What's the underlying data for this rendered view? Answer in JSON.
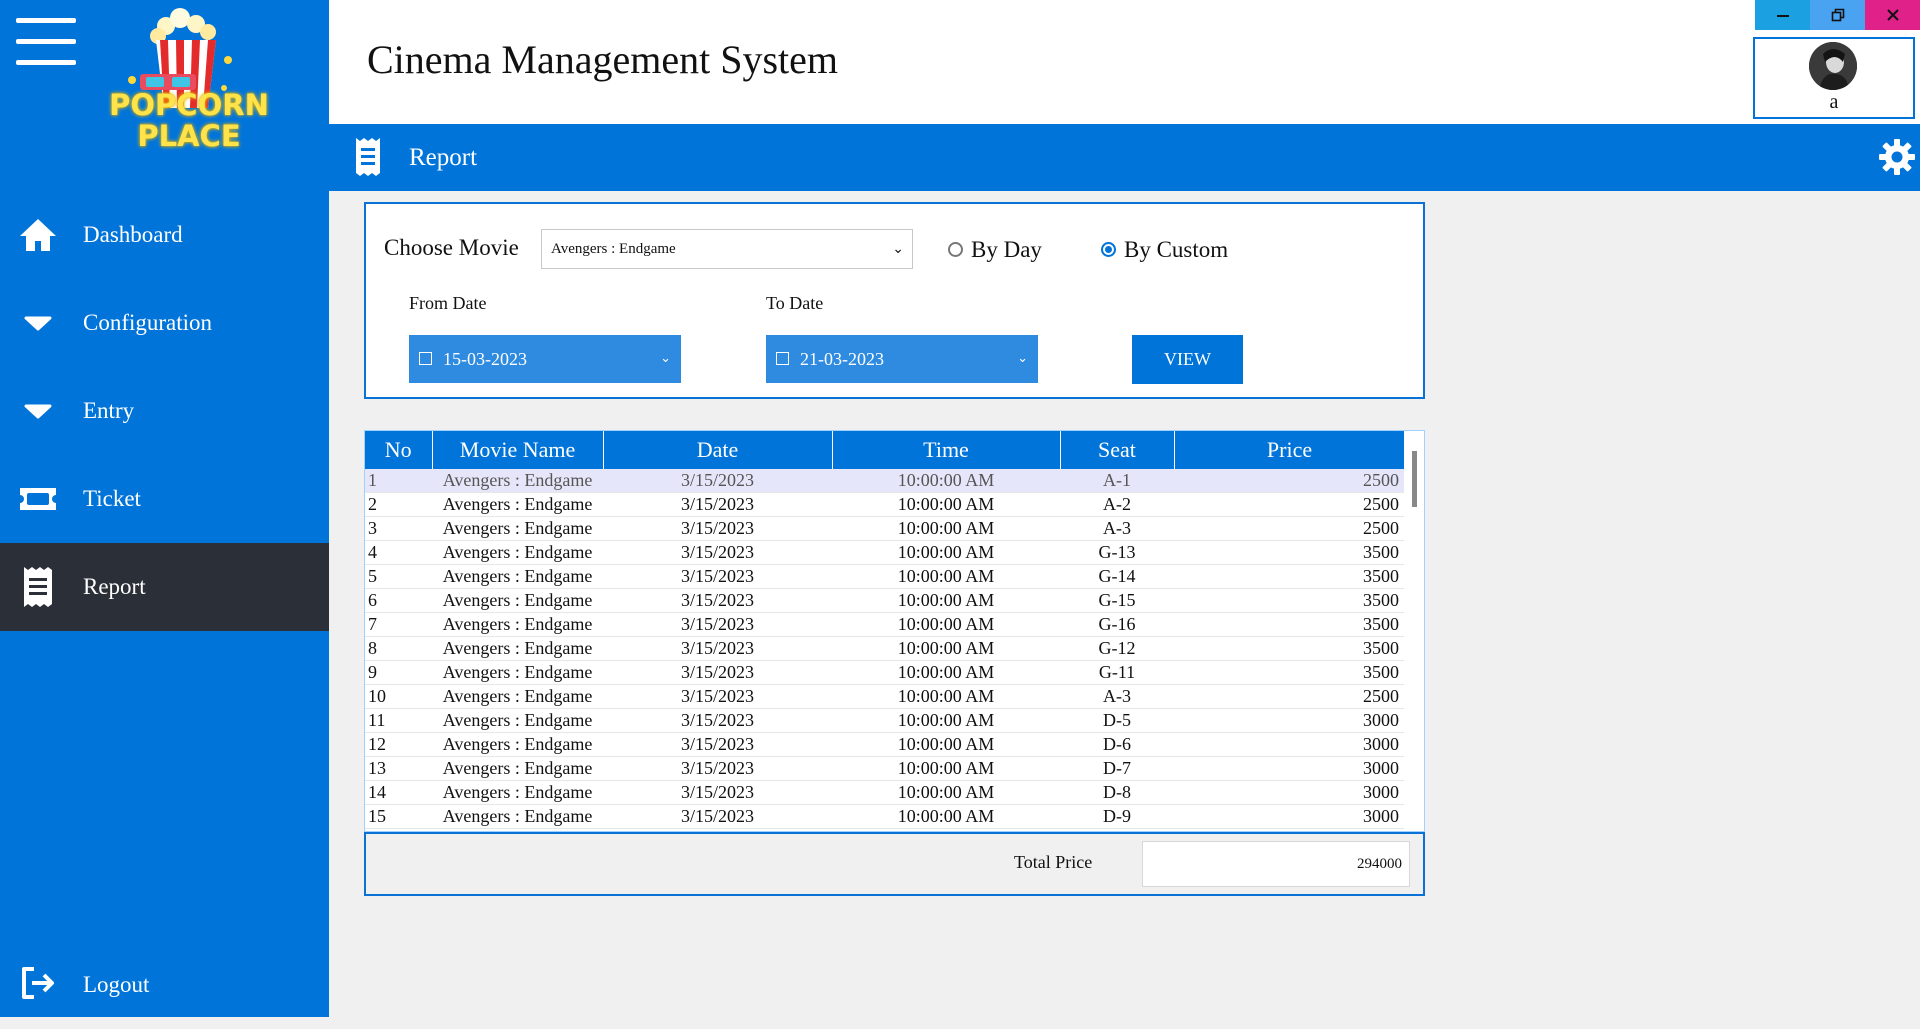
{
  "app": {
    "title": "Cinema Management System"
  },
  "logo": {
    "line1": "POPCORN",
    "line2": "PLACE"
  },
  "sidebar": {
    "items": [
      {
        "label": "Dashboard",
        "icon": "home-icon"
      },
      {
        "label": "Configuration",
        "icon": "chevron-down-icon"
      },
      {
        "label": "Entry",
        "icon": "chevron-down-icon"
      },
      {
        "label": "Ticket",
        "icon": "ticket-icon"
      },
      {
        "label": "Report",
        "icon": "receipt-icon",
        "active": true
      }
    ],
    "logout": "Logout"
  },
  "profile": {
    "name": "a"
  },
  "page": {
    "title": "Report"
  },
  "filter": {
    "choose_movie_label": "Choose Movie",
    "movie_value": "Avengers : Endgame",
    "radio_by_day": "By Day",
    "radio_by_custom": "By Custom",
    "selected_mode": "By Custom",
    "from_label": "From Date",
    "to_label": "To Date",
    "from_value": "15-03-2023",
    "to_value": "21-03-2023",
    "view_button": "VIEW"
  },
  "table": {
    "columns": [
      "No",
      "Movie Name",
      "Date",
      "Time",
      "Seat",
      "Price"
    ],
    "rows": [
      [
        "1",
        "Avengers : Endgame",
        "3/15/2023",
        "10:00:00 AM",
        "A-1",
        "2500"
      ],
      [
        "2",
        "Avengers : Endgame",
        "3/15/2023",
        "10:00:00 AM",
        "A-2",
        "2500"
      ],
      [
        "3",
        "Avengers : Endgame",
        "3/15/2023",
        "10:00:00 AM",
        "A-3",
        "2500"
      ],
      [
        "4",
        "Avengers : Endgame",
        "3/15/2023",
        "10:00:00 AM",
        "G-13",
        "3500"
      ],
      [
        "5",
        "Avengers : Endgame",
        "3/15/2023",
        "10:00:00 AM",
        "G-14",
        "3500"
      ],
      [
        "6",
        "Avengers : Endgame",
        "3/15/2023",
        "10:00:00 AM",
        "G-15",
        "3500"
      ],
      [
        "7",
        "Avengers : Endgame",
        "3/15/2023",
        "10:00:00 AM",
        "G-16",
        "3500"
      ],
      [
        "8",
        "Avengers : Endgame",
        "3/15/2023",
        "10:00:00 AM",
        "G-12",
        "3500"
      ],
      [
        "9",
        "Avengers : Endgame",
        "3/15/2023",
        "10:00:00 AM",
        "G-11",
        "3500"
      ],
      [
        "10",
        "Avengers : Endgame",
        "3/15/2023",
        "10:00:00 AM",
        "A-3",
        "2500"
      ],
      [
        "11",
        "Avengers : Endgame",
        "3/15/2023",
        "10:00:00 AM",
        "D-5",
        "3000"
      ],
      [
        "12",
        "Avengers : Endgame",
        "3/15/2023",
        "10:00:00 AM",
        "D-6",
        "3000"
      ],
      [
        "13",
        "Avengers : Endgame",
        "3/15/2023",
        "10:00:00 AM",
        "D-7",
        "3000"
      ],
      [
        "14",
        "Avengers : Endgame",
        "3/15/2023",
        "10:00:00 AM",
        "D-8",
        "3000"
      ],
      [
        "15",
        "Avengers : Endgame",
        "3/15/2023",
        "10:00:00 AM",
        "D-9",
        "3000"
      ]
    ],
    "selected_row": 0
  },
  "total": {
    "label": "Total Price",
    "value": "294000"
  },
  "colors": {
    "primary": "#0074d9",
    "sidebar_active": "#2b2f37",
    "minimize": "#1ba1e2",
    "restore": "#4aa3f0",
    "close": "#e0218a"
  }
}
